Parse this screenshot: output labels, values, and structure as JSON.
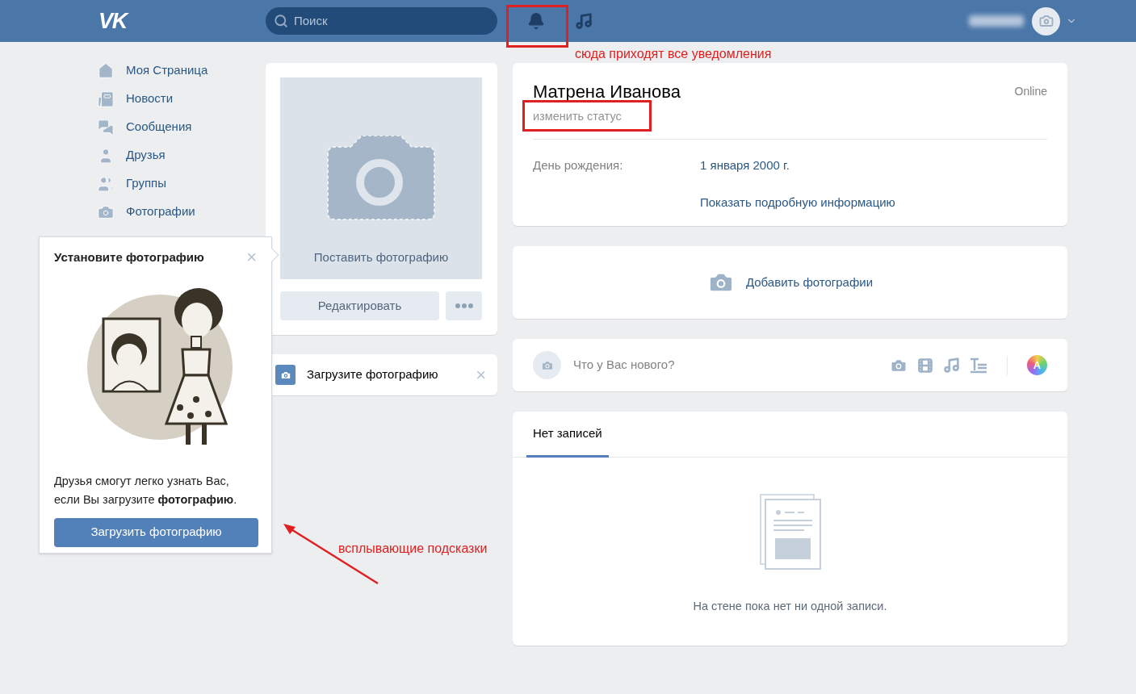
{
  "header": {
    "logo": "VK",
    "search": {
      "placeholder": "Поиск"
    }
  },
  "sidebar": {
    "items": [
      {
        "kind": "home",
        "label": "Моя Страница"
      },
      {
        "kind": "news",
        "label": "Новости"
      },
      {
        "kind": "messages",
        "label": "Сообщения"
      },
      {
        "kind": "friends",
        "label": "Друзья"
      },
      {
        "kind": "groups",
        "label": "Группы"
      },
      {
        "kind": "photos",
        "label": "Фотографии"
      }
    ]
  },
  "profile_photo": {
    "caption": "Поставить фотографию",
    "edit_button": "Редактировать",
    "hint": {
      "text": "Загрузите фотографию",
      "close": "×"
    }
  },
  "profile": {
    "name": "Матрена Иванова",
    "status": "изменить статус",
    "online": "Online",
    "fields": [
      {
        "label": "День рождения:",
        "value": "1 января 2000 г."
      }
    ],
    "more_link": "Показать подробную информацию"
  },
  "add_photos": "Добавить фотографии",
  "composer": {
    "placeholder": "Что у Вас нового?",
    "poster_label": "A"
  },
  "wall": {
    "tabs": [
      {
        "label": "Нет записей",
        "selected": true
      }
    ],
    "empty_text": "На стене пока нет ни одной записи."
  },
  "popup": {
    "title": "Установите фотографию",
    "close": "×",
    "text": "Друзья смогут легко узнать Вас, если Вы загрузите **фотографию**.",
    "button": "Загрузить фотографию"
  },
  "annotations": [
    {
      "kind": "notifications",
      "text": "сюда приходят все уведомления"
    },
    {
      "kind": "popup",
      "text": "всплывающие подсказки"
    }
  ]
}
